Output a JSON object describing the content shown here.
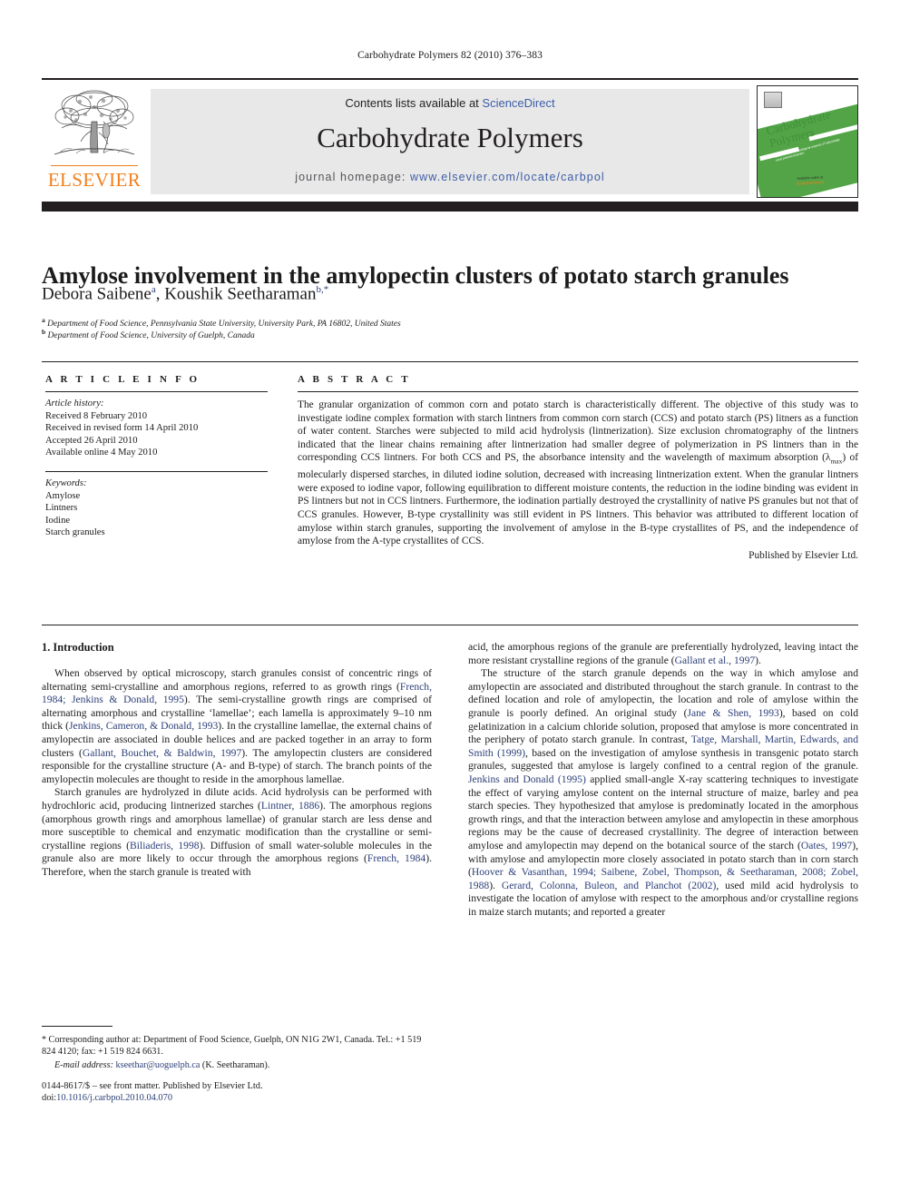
{
  "running_head": "Carbohydrate Polymers 82 (2010) 376–383",
  "masthead": {
    "contents_prefix": "Contents lists available at ",
    "sciencedirect": "ScienceDirect",
    "journal_title": "Carbohydrate Polymers",
    "homepage_label": "journal homepage: ",
    "homepage_url": "www.elsevier.com/locate/carbpol",
    "publisher_wordmark": "ELSEVIER",
    "cover": {
      "title_line1": "Carbohydrate",
      "title_line2": "Polymers",
      "subtitle": "Scientific and technological aspects of industrially used polysaccharides",
      "footer_brand": "Available online at",
      "footer_mark": "ScienceDirect"
    },
    "accent_orange": "#f07f1a",
    "accent_blue": "#3d5ea8",
    "panel_gray": "#e8e8e8",
    "band_black": "#231f20",
    "cover_green": "#52a447"
  },
  "article": {
    "title": "Amylose involvement in the amylopectin clusters of potato starch granules",
    "authors": [
      {
        "name": "Debora Saibene",
        "marks": "a"
      },
      {
        "name": "Koushik Seetharaman",
        "marks": "b,*"
      }
    ],
    "affiliations": [
      {
        "mark": "a",
        "text": "Department of Food Science, Pennsylvania State University, University Park, PA 16802, United States"
      },
      {
        "mark": "b",
        "text": "Department of Food Science, University of Guelph, Canada"
      }
    ]
  },
  "article_info": {
    "heading": "A R T I C L E  I N F O",
    "history_label": "Article history:",
    "history": [
      "Received 8 February 2010",
      "Received in revised form 14 April 2010",
      "Accepted 26 April 2010",
      "Available online 4 May 2010"
    ],
    "keywords_label": "Keywords:",
    "keywords": [
      "Amylose",
      "Lintners",
      "Iodine",
      "Starch granules"
    ]
  },
  "abstract": {
    "heading": "A B S T R A C T",
    "body": "The granular organization of common corn and potato starch is characteristically different. The objective of this study was to investigate iodine complex formation with starch lintners from common corn starch (CCS) and potato starch (PS) litners as a function of water content. Starches were subjected to mild acid hydrolysis (lintnerization). Size exclusion chromatography of the lintners indicated that the linear chains remaining after lintnerization had smaller degree of polymerization in PS lintners than in the corresponding CCS lintners. For both CCS and PS, the absorbance intensity and the wavelength of maximum absorption (λmax) of molecularly dispersed starches, in diluted iodine solution, decreased with increasing lintnerization extent. When the granular lintners were exposed to iodine vapor, following equilibration to different moisture contents, the reduction in the iodine binding was evident in PS lintners but not in CCS lintners. Furthermore, the iodination partially destroyed the crystallinity of native PS granules but not that of CCS granules. However, B-type crystallinity was still evident in PS lintners. This behavior was attributed to different location of amylose within starch granules, supporting the involvement of amylose in the B-type crystallites of PS, and the independence of amylose from the A-type crystallites of CCS.",
    "closing": "Published by Elsevier Ltd."
  },
  "body": {
    "section_number_title": "1. Introduction",
    "left_paragraphs": [
      {
        "segments": [
          {
            "t": "When observed by optical microscopy, starch granules consist of concentric rings of alternating semi-crystalline and amorphous regions, referred to as growth rings ("
          },
          {
            "t": "French, 1984; Jenkins & Donald, 1995",
            "ref": true
          },
          {
            "t": "). The semi-crystalline growth rings are comprised of alternating amorphous and crystalline ‘lamellae’; each lamella is approximately 9–10 nm thick ("
          },
          {
            "t": "Jenkins, Cameron, & Donald, 1993",
            "ref": true
          },
          {
            "t": "). In the crystalline lamellae, the external chains of amylopectin are associated in double helices and are packed together in an array to form clusters ("
          },
          {
            "t": "Gallant, Bouchet, & Baldwin, 1997",
            "ref": true
          },
          {
            "t": "). The amylopectin clusters are considered responsible for the crystalline structure (A- and B-type) of starch. The branch points of the amylopectin molecules are thought to reside in the amorphous lamellae."
          }
        ]
      },
      {
        "segments": [
          {
            "t": "Starch granules are hydrolyzed in dilute acids. Acid hydrolysis can be performed with hydrochloric acid, producing lintnerized starches ("
          },
          {
            "t": "Lintner, 1886",
            "ref": true
          },
          {
            "t": "). The amorphous regions (amorphous growth rings and amorphous lamellae) of granular starch are less dense and more susceptible to chemical and enzymatic modification than the crystalline or semi-crystalline regions ("
          },
          {
            "t": "Biliaderis, 1998",
            "ref": true
          },
          {
            "t": "). Diffusion of small water-soluble molecules in the granule also are more likely to occur through the amorphous regions ("
          },
          {
            "t": "French, 1984",
            "ref": true
          },
          {
            "t": "). Therefore, when the starch granule is treated with"
          }
        ]
      }
    ],
    "right_paragraphs": [
      {
        "no_indent": true,
        "segments": [
          {
            "t": "acid, the amorphous regions of the granule are preferentially hydrolyzed, leaving intact the more resistant crystalline regions of the granule ("
          },
          {
            "t": "Gallant et al., 1997",
            "ref": true
          },
          {
            "t": ")."
          }
        ]
      },
      {
        "segments": [
          {
            "t": "The structure of the starch granule depends on the way in which amylose and amylopectin are associated and distributed throughout the starch granule. In contrast to the defined location and role of amylopectin, the location and role of amylose within the granule is poorly defined. An original study ("
          },
          {
            "t": "Jane & Shen, 1993",
            "ref": true
          },
          {
            "t": "), based on cold gelatinization in a calcium chloride solution, proposed that amylose is more concentrated in the periphery of potato starch granule. In contrast, "
          },
          {
            "t": "Tatge, Marshall, Martin, Edwards, and Smith (1999)",
            "ref": true
          },
          {
            "t": ", based on the investigation of amylose synthesis in transgenic potato starch granules, suggested that amylose is largely confined to a central region of the granule. "
          },
          {
            "t": "Jenkins and Donald (1995)",
            "ref": true
          },
          {
            "t": " applied small-angle X-ray scattering techniques to investigate the effect of varying amylose content on the internal structure of maize, barley and pea starch species. They hypothesized that amylose is predominatly located in the amorphous growth rings, and that the interaction between amylose and amylopectin in these amorphous regions may be the cause of decreased crystallinity. The degree of interaction between amylose and amylopectin may depend on the botanical source of the starch ("
          },
          {
            "t": "Oates, 1997",
            "ref": true
          },
          {
            "t": "), with amylose and amylopectin more closely associated in potato starch than in corn starch ("
          },
          {
            "t": "Hoover & Vasanthan, 1994; Saibene, Zobel, Thompson, & Seetharaman, 2008; Zobel, 1988",
            "ref": true
          },
          {
            "t": "). "
          },
          {
            "t": "Gerard, Colonna, Buleon, and Planchot (2002)",
            "ref": true
          },
          {
            "t": ", used mild acid hydrolysis to investigate the location of amylose with respect to the amorphous and/or crystalline regions in maize starch mutants; and reported a greater"
          }
        ]
      }
    ]
  },
  "footnotes": {
    "corresponding_marker": "*",
    "corresponding": " Corresponding author at: Department of Food Science, Guelph, ON N1G 2W1, Canada. Tel.: +1 519 824 4120; fax: +1 519 824 6631.",
    "email_label": "E-mail address:",
    "email": "kseethar@uoguelph.ca",
    "email_suffix": " (K. Seetharaman)."
  },
  "imprint": {
    "front_matter": "0144-8617/$ – see front matter. Published by Elsevier Ltd.",
    "doi_label": "doi:",
    "doi": "10.1016/j.carbpol.2010.04.070"
  }
}
